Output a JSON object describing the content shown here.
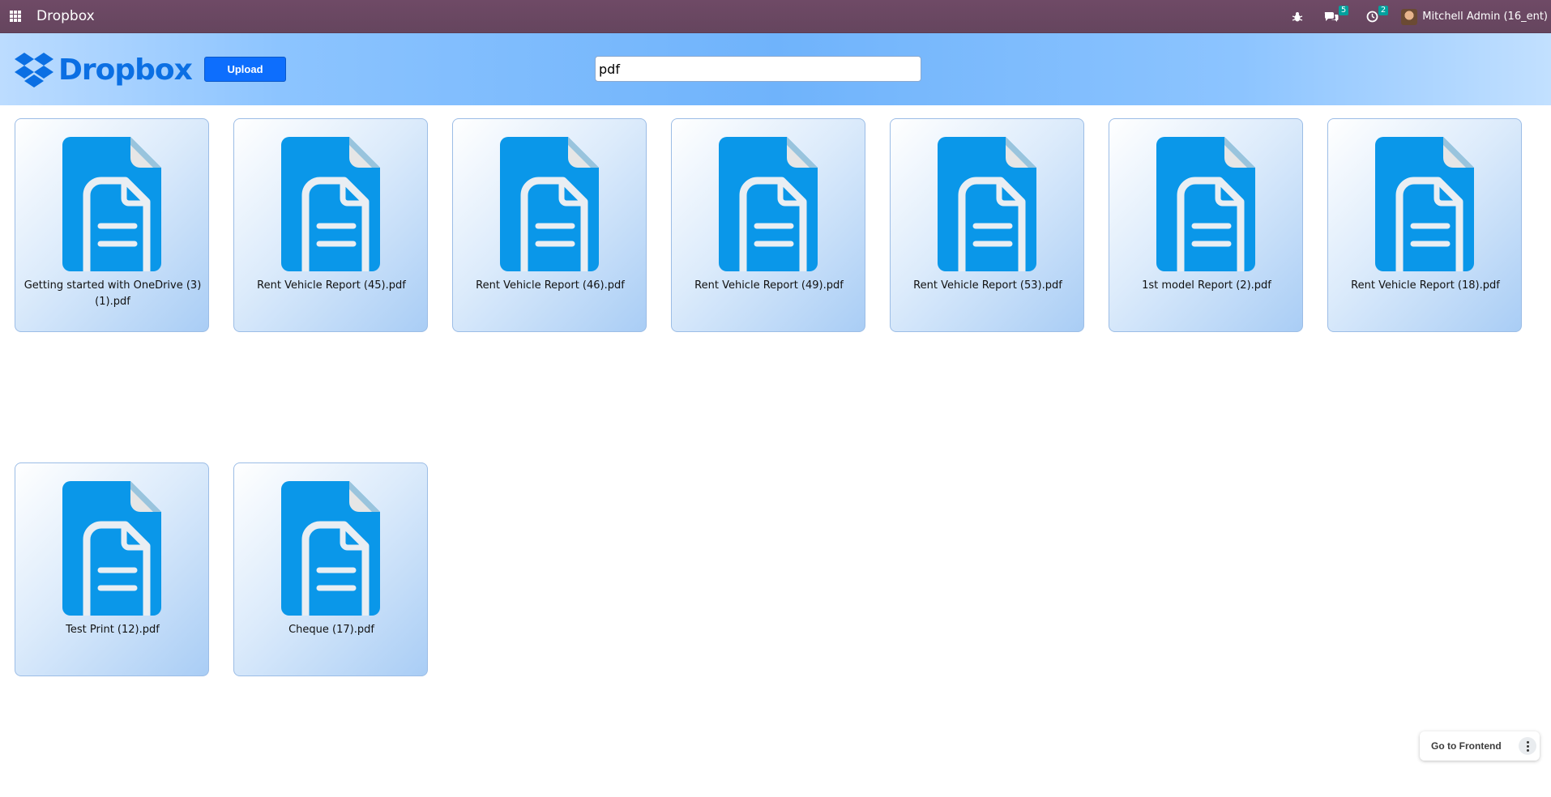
{
  "topbar": {
    "app_title": "Dropbox",
    "messages_badge": "5",
    "activities_badge": "2",
    "user_name": "Mitchell Admin (16_ent)"
  },
  "header": {
    "logo_text": "Dropbox",
    "upload_label": "Upload",
    "search_value": "pdf"
  },
  "files": [
    {
      "name": "Getting started with OneDrive (3) (1).pdf"
    },
    {
      "name": "Rent Vehicle Report (45).pdf"
    },
    {
      "name": "Rent Vehicle Report (46).pdf"
    },
    {
      "name": "Rent Vehicle Report (49).pdf"
    },
    {
      "name": "Rent Vehicle Report (53).pdf"
    },
    {
      "name": "1st model Report (2).pdf"
    },
    {
      "name": "Rent Vehicle Report (18).pdf"
    },
    {
      "name": "Test Print (12).pdf"
    },
    {
      "name": "Cheque (17).pdf"
    }
  ],
  "footer": {
    "frontend_label": "Go to Frontend"
  },
  "colors": {
    "navbar": "#714b67",
    "brand_blue": "#0b6fe3",
    "doc_blue": "#0a97e9"
  },
  "icons": {
    "apps": "apps-grid-icon",
    "debug": "bug-icon",
    "messages": "chat-icon",
    "activities": "clock-icon",
    "file": "document-icon",
    "more": "kebab-icon"
  }
}
